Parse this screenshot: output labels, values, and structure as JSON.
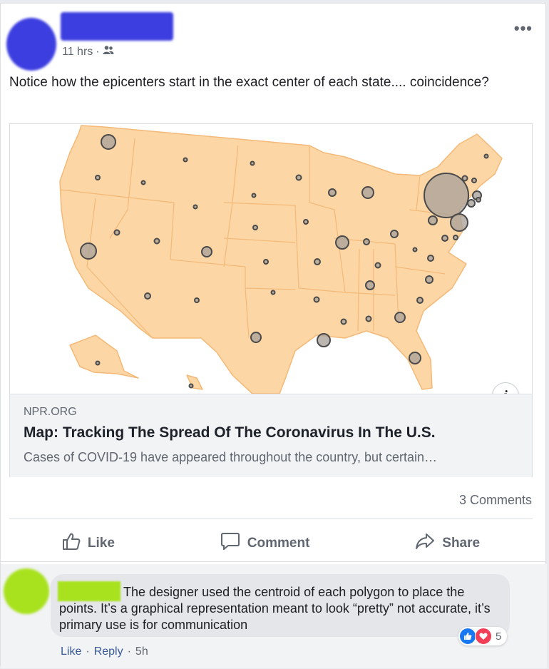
{
  "post": {
    "time": "11 hrs",
    "audience_icon": "friends-icon",
    "menu_icon": "more-horizontal-icon",
    "text": "Notice how the epicenters start in the exact center of each state.... coincidence?"
  },
  "link_card": {
    "domain": "NPR.ORG",
    "title": "Map: Tracking The Spread Of The Coronavirus In The U.S.",
    "description": "Cases of COVID-19 have appeared throughout the country, but certain…",
    "info_icon": "info-icon",
    "map_colors": {
      "land": "#fcd6a4",
      "border": "#f4b978",
      "bubble_fill": "#a9a29a",
      "bubble_stroke": "#4a4a4a"
    }
  },
  "stats": {
    "comments": "3 Comments"
  },
  "actions": {
    "like": "Like",
    "comment": "Comment",
    "share": "Share"
  },
  "comment": {
    "text": "The designer used the centroid of each polygon to place the points. It’s a graphical representation meant to look “pretty” not accurate, it’s primary use is for communication",
    "reaction_count": "5",
    "like": "Like",
    "reply": "Reply",
    "time": "5h"
  }
}
